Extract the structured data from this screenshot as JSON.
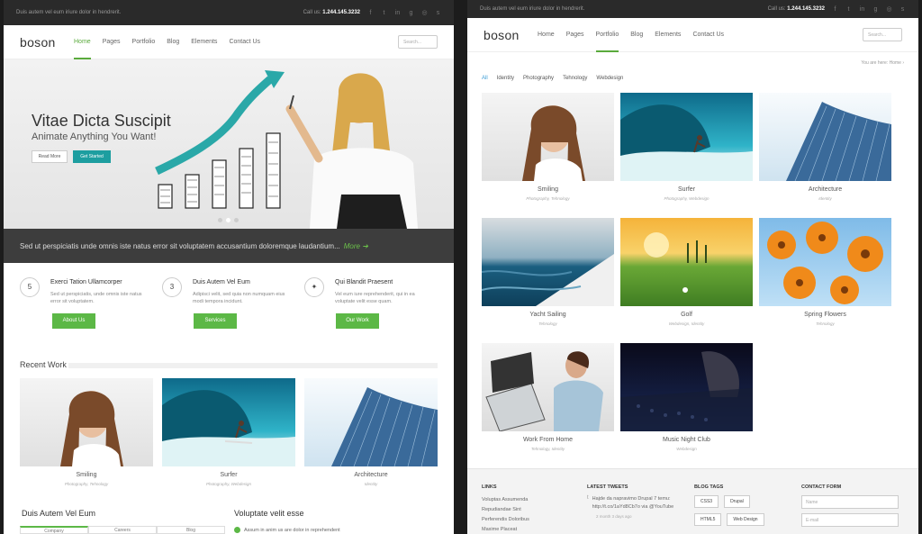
{
  "left": {
    "topbar": {
      "text": "Duis autem vel eum iriure dolor in hendrerit.",
      "call_label": "Call us:",
      "phone": "1.244.145.3232"
    },
    "logo": "boson",
    "menu": [
      "Home",
      "Pages",
      "Portfolio",
      "Blog",
      "Elements",
      "Contact Us"
    ],
    "search_placeholder": "Search...",
    "hero": {
      "title": "Vitae Dicta Suscipit",
      "subtitle": "Animate Anything You Want!",
      "btn1": "Read More",
      "btn2": "Get Started"
    },
    "banner": {
      "text": "Sed ut perspiciatis unde omnis iste natus error sit voluptatem accusantium doloremque laudantium...",
      "more": "More"
    },
    "features": [
      {
        "icon": "html5-icon",
        "title": "Exerci Tation Ullamcorper",
        "text": "Sed ut perspiciatis, unde omnis iste natus error sit voluptatem.",
        "button": "About Us"
      },
      {
        "icon": "css3-icon",
        "title": "Duis Autem Vel Eum",
        "text": "Adipisci velit, sed quia non numquam eius modi tempora incidunt.",
        "button": "Services"
      },
      {
        "icon": "wand-icon",
        "title": "Qui Blandit Praesent",
        "text": "Vel eum iure reprehenderit, qui in ea voluptate velit esse quam.",
        "button": "Our Work"
      }
    ],
    "recent_work_title": "Recent Work",
    "works": [
      {
        "title": "Smiling",
        "sub": "Photography, Tehnology"
      },
      {
        "title": "Surfer",
        "sub": "Photography, Webdesign"
      },
      {
        "title": "Architecture",
        "sub": "Identity"
      }
    ],
    "bottom": {
      "left_title": "Duis Autem Vel Eum",
      "right_title": "Voluptate velit esse",
      "tabs": [
        "Company",
        "Careers",
        "Blog"
      ],
      "check_item": "Assum in anim us are dolor in reprehendent"
    }
  },
  "right": {
    "topbar": {
      "text": "Duis autem vel eum iriure dolor in hendrerit.",
      "call_label": "Call us:",
      "phone": "1.244.145.3232"
    },
    "logo": "boson",
    "menu": [
      "Home",
      "Pages",
      "Portfolio",
      "Blog",
      "Elements",
      "Contact Us"
    ],
    "search_placeholder": "Search...",
    "breadcrumb": "You are here:  Home  ›",
    "filters": [
      "All",
      "Identity",
      "Photography",
      "Tehnology",
      "Webdesign"
    ],
    "items": [
      {
        "title": "Smiling",
        "sub": "Photography, Tehnology"
      },
      {
        "title": "Surfer",
        "sub": "Photography, Webdesign"
      },
      {
        "title": "Architecture",
        "sub": "Identity"
      },
      {
        "title": "Yacht Sailing",
        "sub": "Tehnology"
      },
      {
        "title": "Golf",
        "sub": "Webdesign, Identity"
      },
      {
        "title": "Spring Flowers",
        "sub": "Tehnology"
      },
      {
        "title": "Work From Home",
        "sub": "Tehnology, Identity"
      },
      {
        "title": "Music Night Club",
        "sub": "Webdesign"
      }
    ],
    "footer": {
      "links_title": "LINKS",
      "links": [
        "Voluptas Assumenda",
        "Repudiandae Sint",
        "Perferendis Doloribus",
        "Maxime Placeat"
      ],
      "tweets_title": "LATEST TWEETS",
      "tweet": "Hajde da napravimo Drupal 7 temu: http://t.co/1aYd8Cb7o via @YouTube",
      "tweet_meta": "2 month 3 days ago",
      "tags_title": "BLOG TAGS",
      "tags": [
        "CSS3",
        "Drupal",
        "HTML5",
        "Web Design"
      ],
      "contact_title": "CONTACT FORM",
      "name_placeholder": "Name",
      "email_placeholder": "E-mail"
    }
  }
}
